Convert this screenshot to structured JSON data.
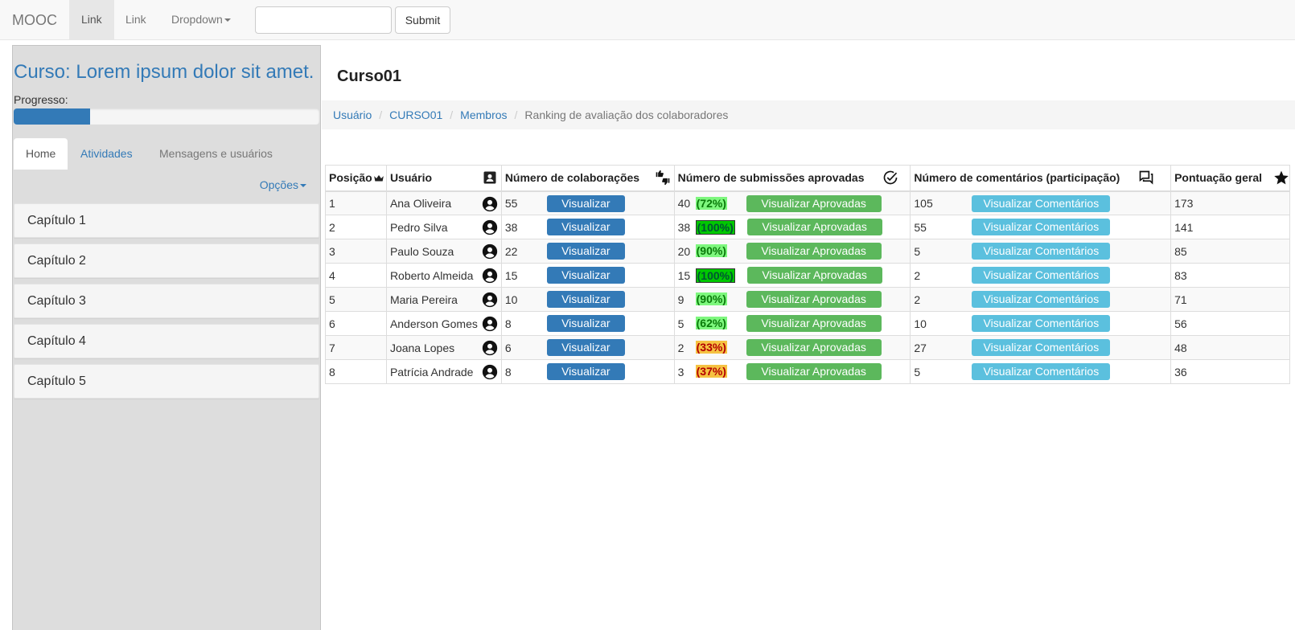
{
  "navbar": {
    "brand": "MOOC",
    "links": [
      "Link",
      "Link"
    ],
    "dropdown": "Dropdown",
    "search_value": "",
    "submit": "Submit"
  },
  "sidebar": {
    "course_title": "Curso: Lorem ipsum dolor sit amet.",
    "progress_label": "Progresso:",
    "progress_fraction": 0.25,
    "tabs": [
      "Home",
      "Atividades",
      "Mensagens e usuários"
    ],
    "options": "Opções",
    "chapters": [
      "Capítulo 1",
      "Capítulo 2",
      "Capítulo 3",
      "Capítulo 4",
      "Capítulo 5"
    ]
  },
  "main": {
    "title": "Curso01",
    "breadcrumb": [
      "Usuário",
      "CURSO01",
      "Membros",
      "Ranking de avaliação dos colaboradores"
    ]
  },
  "table": {
    "headers": [
      "Posição",
      "Usuário",
      "Número de colaborações",
      "Número de submissões aprovadas",
      "Número de comentários (participação)",
      "Pontuação geral"
    ],
    "header_icons": [
      "crown-icon",
      "contact-card-icon",
      "thumbs-up-down-icon",
      "check-circle-icon",
      "comments-icon",
      "star-icon"
    ],
    "buttons": {
      "collab": "Visualizar",
      "approved": "Visualizar Aprovadas",
      "comments": "Visualizar Comentários"
    },
    "rows": [
      {
        "pos": "1",
        "user": "Ana Oliveira",
        "collab": "55",
        "approved": "40",
        "pct": "(72%)",
        "pct_level": "good",
        "comments": "105",
        "score": "173"
      },
      {
        "pos": "2",
        "user": "Pedro Silva",
        "collab": "38",
        "approved": "38",
        "pct": "(100%)",
        "pct_level": "full",
        "comments": "55",
        "score": "141"
      },
      {
        "pos": "3",
        "user": "Paulo Souza",
        "collab": "22",
        "approved": "20",
        "pct": "(90%)",
        "pct_level": "good",
        "comments": "5",
        "score": "85"
      },
      {
        "pos": "4",
        "user": "Roberto Almeida",
        "collab": "15",
        "approved": "15",
        "pct": "(100%)",
        "pct_level": "full",
        "comments": "2",
        "score": "83"
      },
      {
        "pos": "5",
        "user": "Maria Pereira",
        "collab": "10",
        "approved": "9",
        "pct": "(90%)",
        "pct_level": "good",
        "comments": "2",
        "score": "71"
      },
      {
        "pos": "6",
        "user": "Anderson Gomes",
        "collab": "8",
        "approved": "5",
        "pct": "(62%)",
        "pct_level": "good",
        "comments": "10",
        "score": "56"
      },
      {
        "pos": "7",
        "user": "Joana Lopes",
        "collab": "6",
        "approved": "2",
        "pct": "(33%)",
        "pct_level": "bad",
        "comments": "27",
        "score": "48"
      },
      {
        "pos": "8",
        "user": "Patrícia Andrade",
        "collab": "8",
        "approved": "3",
        "pct": "(37%)",
        "pct_level": "bad",
        "comments": "5",
        "score": "36"
      }
    ]
  },
  "colors": {
    "primary": "#337ab7",
    "success": "#5cb85c",
    "info": "#5bc0de",
    "pct_good": "#7ef77e",
    "pct_full": "#00c800",
    "pct_bad": "#f5c242"
  }
}
